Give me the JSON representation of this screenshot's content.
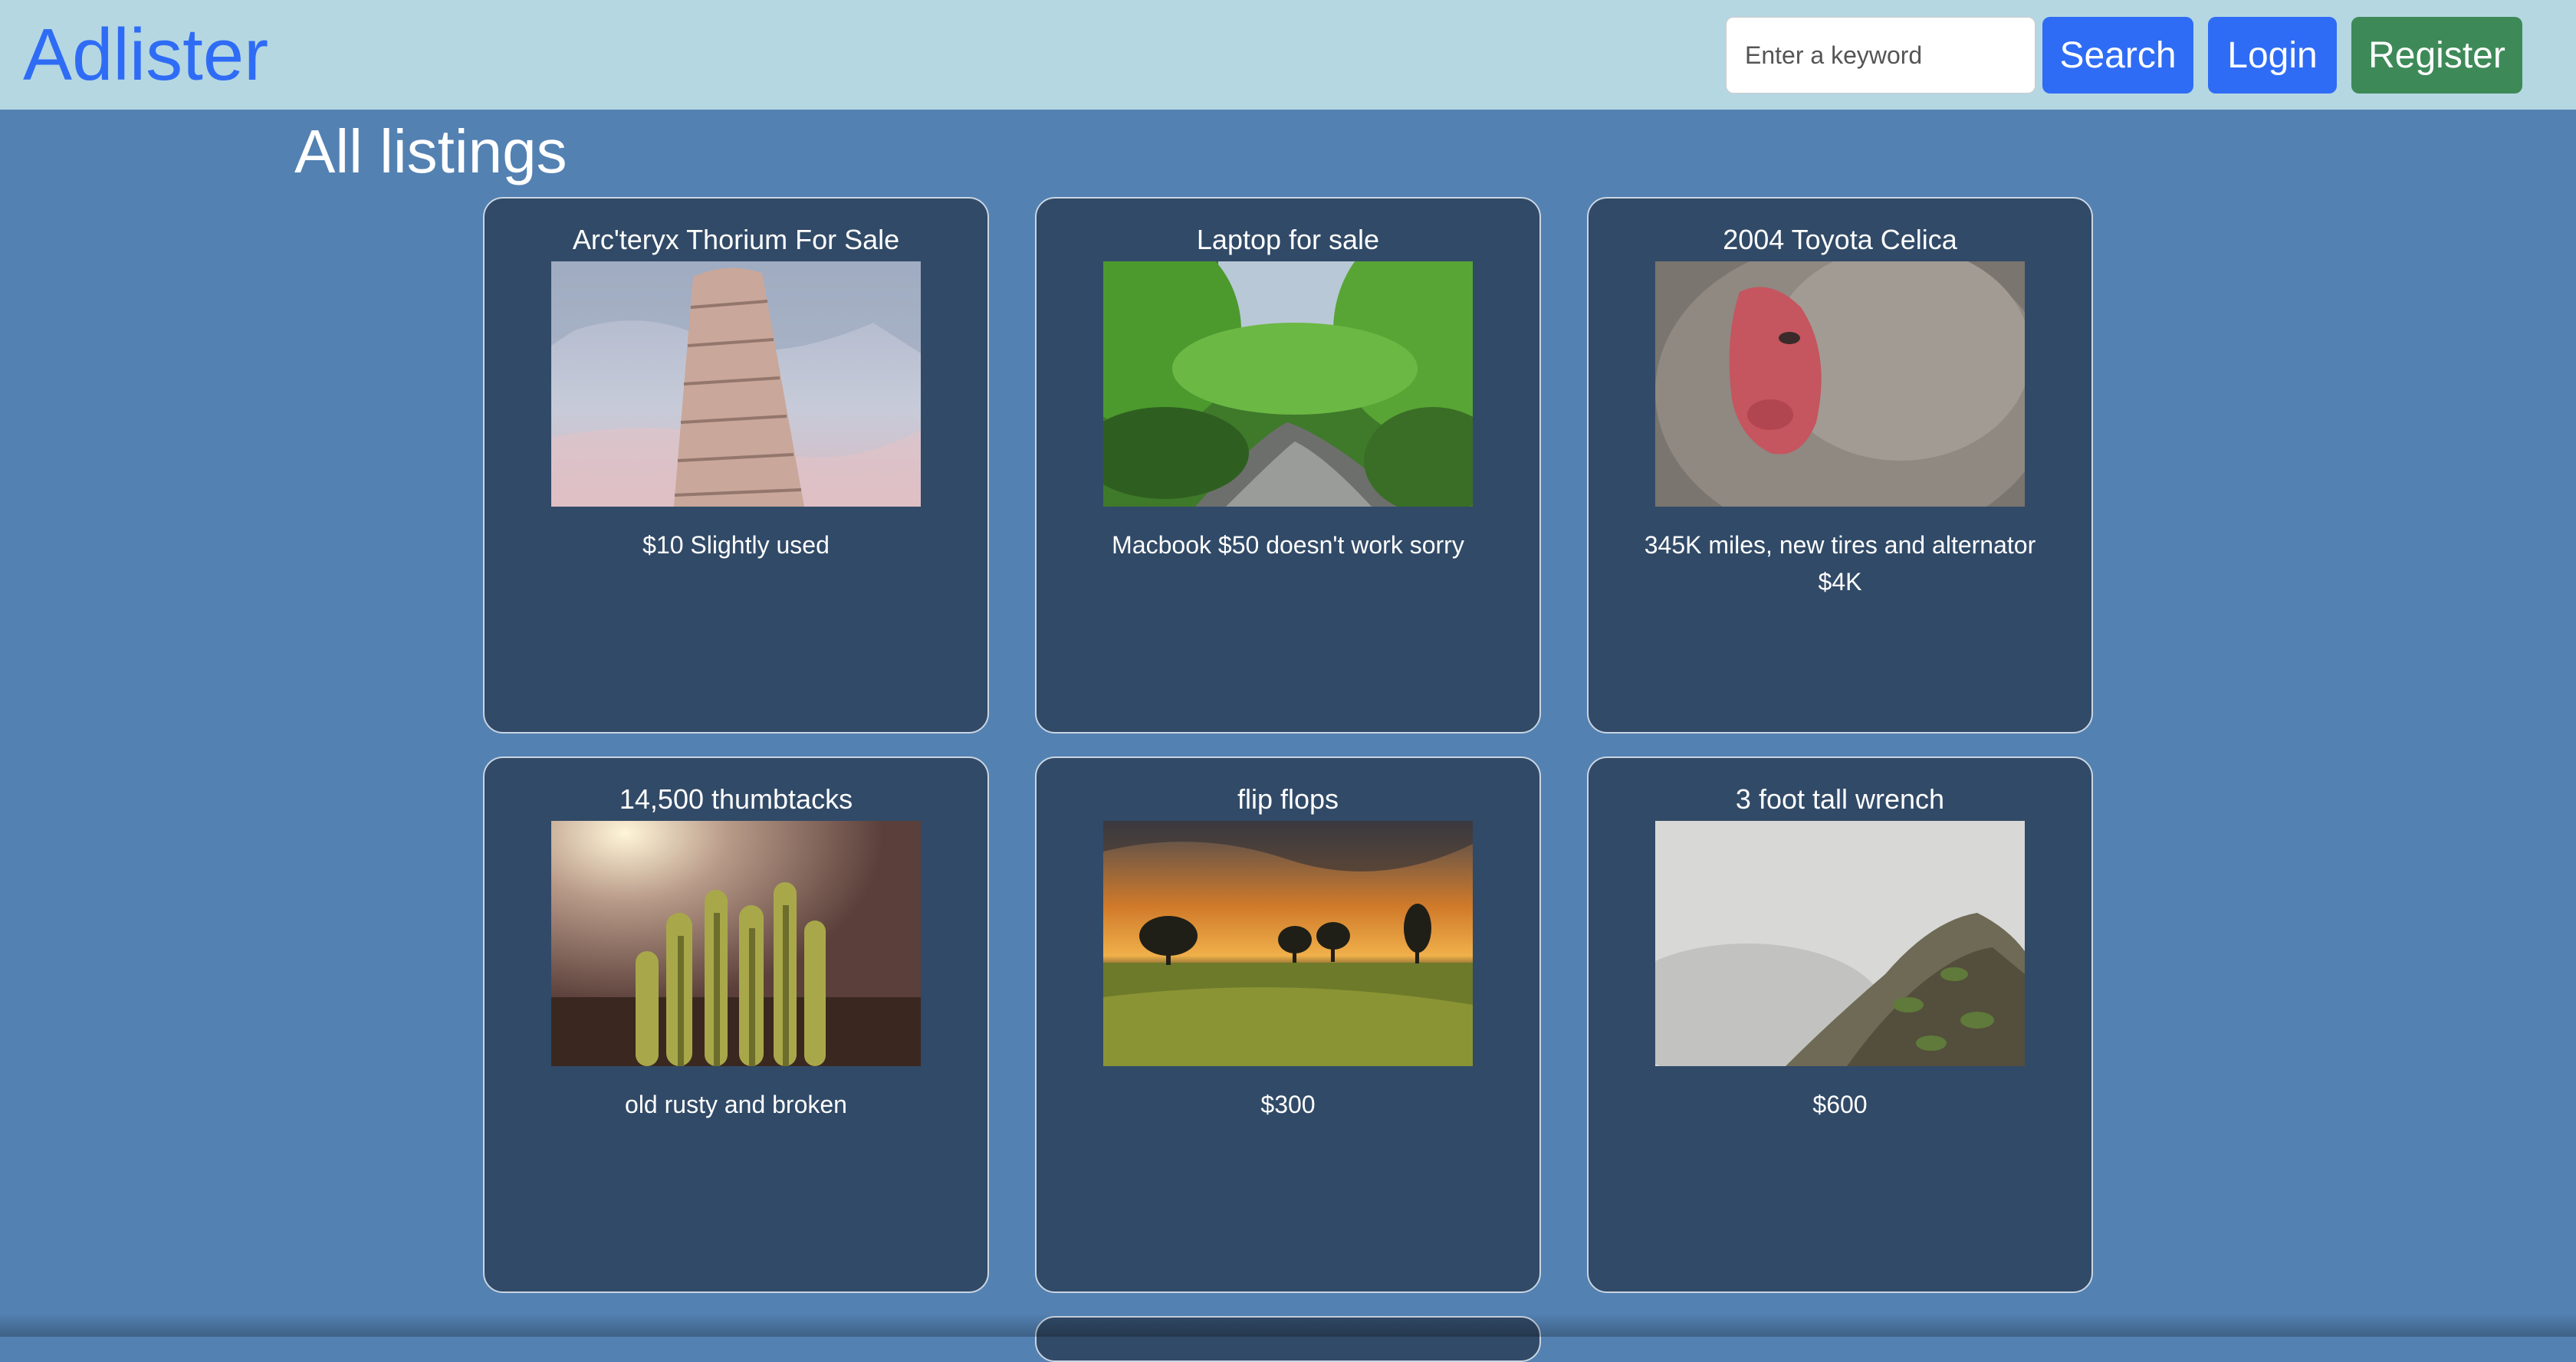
{
  "navbar": {
    "brand": "Adlister",
    "search_placeholder": "Enter a keyword",
    "search_label": "Search",
    "login_label": "Login",
    "register_label": "Register"
  },
  "page": {
    "title": "All listings"
  },
  "listings": [
    {
      "title": "Arc'teryx Thorium For Sale",
      "description": "$10 Slightly used",
      "image": "leaning-tower-photo"
    },
    {
      "title": "Laptop for sale",
      "description": "Macbook $50 doesn't work sorry",
      "image": "forest-stream-photo"
    },
    {
      "title": "2004 Toyota Celica",
      "description": "345K miles, new tires and alternator $4K",
      "image": "snow-monkey-photo"
    },
    {
      "title": "14,500 thumbtacks",
      "description": "old rusty and broken",
      "image": "cactus-photo"
    },
    {
      "title": "flip flops",
      "description": "$300",
      "image": "sunset-field-photo"
    },
    {
      "title": "3 foot tall wrench",
      "description": "$600",
      "image": "misty-mountain-photo"
    }
  ],
  "colors": {
    "navbar_bg": "#b5d7e2",
    "page_bg": "#5381b2",
    "card_bg": "#314a67",
    "brand": "#2f6cf5",
    "primary_button": "#2f6cf5",
    "register_button": "#3d8a58"
  }
}
